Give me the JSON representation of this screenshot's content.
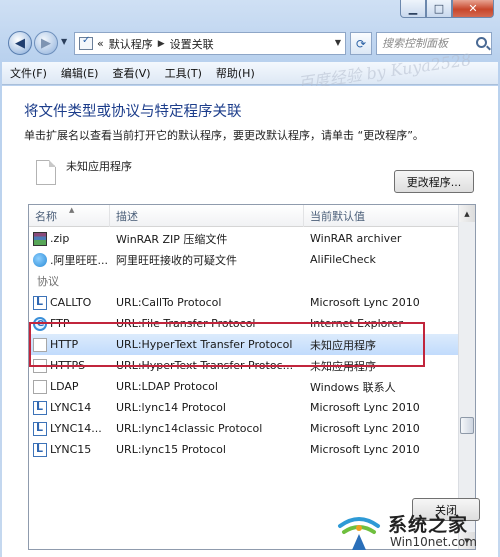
{
  "window": {
    "minimize_glyph": "▁",
    "maximize_glyph": "□",
    "close_glyph": "✕"
  },
  "address_bar": {
    "overflow": "«",
    "crumbs": [
      "默认程序",
      "设置关联"
    ],
    "search_placeholder": "搜索控制面板"
  },
  "menu": [
    "文件(F)",
    "编辑(E)",
    "查看(V)",
    "工具(T)",
    "帮助(H)"
  ],
  "watermark": "百度经验 by Kuya2528",
  "page": {
    "title": "将文件类型或协议与特定程序关联",
    "description": "单击扩展名以查看当前打开它的默认程序，要更改默认程序，请单击 “更改程序”。",
    "current_program": "未知应用程序",
    "change_button": "更改程序..."
  },
  "table": {
    "columns": [
      "名称",
      "描述",
      "当前默认值"
    ],
    "rows_top": [
      {
        "name": ".zip",
        "description": "WinRAR ZIP 压缩文件",
        "program": "WinRAR archiver",
        "icon": "winrar-icon"
      },
      {
        "name": ".阿里旺旺...",
        "description": "阿里旺旺接收的可疑文件",
        "program": "AliFileCheck",
        "icon": "aliwangwang-icon"
      }
    ],
    "group_label": "协议",
    "rows_protocol": [
      {
        "name": "CALLTO",
        "description": "URL:CallTo Protocol",
        "program": "Microsoft Lync 2010",
        "icon": "lync-icon"
      },
      {
        "name": "FTP",
        "description": "URL:File Transfer Protocol",
        "program": "Internet Explorer",
        "icon": "ie-icon"
      },
      {
        "name": "HTTP",
        "description": "URL:HyperText Transfer Protocol",
        "program": "未知应用程序",
        "icon": "blank-file-icon",
        "selected": true
      },
      {
        "name": "HTTPS",
        "description": "URL:HyperText Transfer Protoc...",
        "program": "未知应用程序",
        "icon": "document-icon"
      },
      {
        "name": "LDAP",
        "description": "URL:LDAP Protocol",
        "program": "Windows 联系人",
        "icon": "blank-file-icon"
      },
      {
        "name": "LYNC14",
        "description": "URL:lync14 Protocol",
        "program": "Microsoft Lync 2010",
        "icon": "lync-icon"
      },
      {
        "name": "LYNC14...",
        "description": "URL:lync14classic Protocol",
        "program": "Microsoft Lync 2010",
        "icon": "lync-icon"
      },
      {
        "name": "LYNC15",
        "description": "URL:lync15 Protocol",
        "program": "Microsoft Lync 2010",
        "icon": "lync-icon"
      }
    ]
  },
  "footer": {
    "close_button": "关闭"
  },
  "logo": {
    "title": "系统之家",
    "url": "Win10net.com"
  },
  "colors": {
    "title_blue": "#1c3d8b",
    "highlight_red": "#c1253c",
    "selection": "#c1dbfc"
  }
}
